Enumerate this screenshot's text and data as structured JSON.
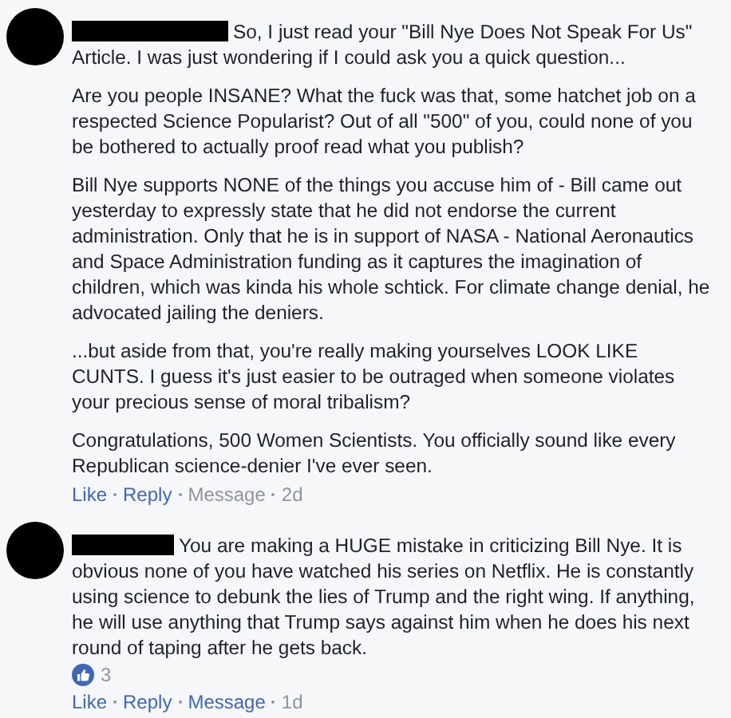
{
  "comments": [
    {
      "author_redacted": true,
      "paragraphs": [
        "So, I just read your \"Bill Nye Does Not Speak For Us\" Article. I was just wondering if I could ask you a quick question...",
        "Are you people INSANE? What the fuck was that, some hatchet job on a respected Science Popularist? Out of all \"500\" of you, could none of you be bothered to actually proof read what you publish?",
        "Bill Nye supports NONE of the things you accuse him of - Bill came out yesterday to expressly state that he did not endorse the current administration. Only that he is in support of NASA - National Aeronautics and Space Administration funding as it captures the imagination of children, which was kinda his whole schtick. For climate change denial, he advocated jailing the deniers.",
        "...but aside from that, you're really making yourselves LOOK LIKE CUNTS. I guess it's just easier to be outraged when someone violates your precious sense of moral tribalism?",
        "Congratulations, 500 Women Scientists. You officially sound like every Republican science-denier I've ever seen."
      ],
      "actions": [
        {
          "label": "Like",
          "disabled": false
        },
        {
          "label": "Reply",
          "disabled": false
        },
        {
          "label": "Message",
          "disabled": true
        }
      ],
      "time": "2d"
    },
    {
      "author_redacted": true,
      "paragraphs": [
        "You are making a HUGE mistake in criticizing Bill Nye. It is obvious none of you have watched his series on Netflix. He is constantly using science to debunk the lies of Trump and the right wing. If anything, he will use anything that Trump says against him when he does his next round of taping after he gets back."
      ],
      "reactions": {
        "count": "3"
      },
      "actions": [
        {
          "label": "Like",
          "disabled": false
        },
        {
          "label": "Reply",
          "disabled": false
        },
        {
          "label": "Message",
          "disabled": false
        }
      ],
      "time": "1d"
    }
  ]
}
